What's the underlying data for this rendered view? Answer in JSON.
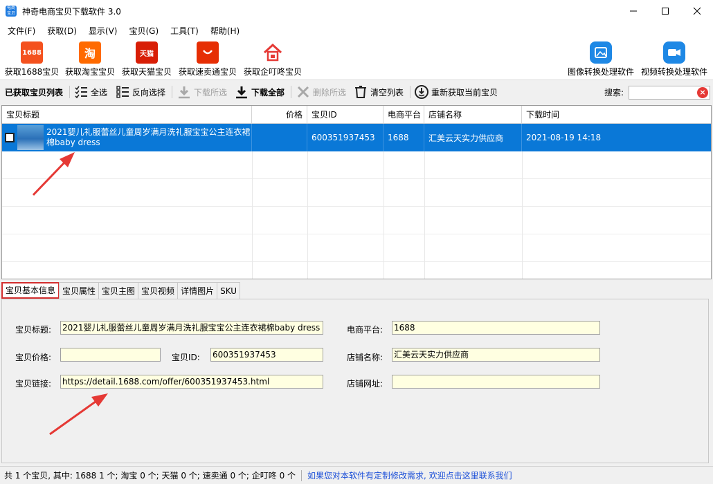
{
  "window": {
    "title": "神奇电商宝贝下载软件 3.0",
    "icon_text": "电商宝贝"
  },
  "menu": [
    "文件(F)",
    "获取(D)",
    "显示(V)",
    "宝贝(G)",
    "工具(T)",
    "帮助(H)"
  ],
  "big_toolbar": {
    "btn_1688": {
      "label": "获取1688宝贝",
      "icon_text": "1688",
      "color": "#f4511e"
    },
    "btn_taobao": {
      "label": "获取淘宝宝贝",
      "icon_text": "淘",
      "color": "#ff6a00"
    },
    "btn_tmall": {
      "label": "获取天猫宝贝",
      "icon_text": "天猫",
      "color": "#d81e06"
    },
    "btn_aliexpress": {
      "label": "获取速卖通宝贝",
      "color": "#e62e04"
    },
    "btn_qidd": {
      "label": "获取企叮咚宝贝",
      "color": "#e53935"
    },
    "btn_image": {
      "label": "图像转换处理软件",
      "color": "#1e88e5"
    },
    "btn_video": {
      "label": "视频转换处理软件",
      "color": "#1e88e5"
    }
  },
  "small_toolbar": {
    "list_label": "已获取宝贝列表",
    "select_all": "全选",
    "invert_select": "反向选择",
    "download_selected": "下载所选",
    "download_all": "下载全部",
    "delete_selected": "删除所选",
    "clear_list": "清空列表",
    "refetch": "重新获取当前宝贝",
    "search_label": "搜索:",
    "search_value": ""
  },
  "grid": {
    "columns": [
      "宝贝标题",
      "价格",
      "宝贝ID",
      "电商平台",
      "店铺名称",
      "下载时间"
    ],
    "rows": [
      {
        "title": "2021婴儿礼服蕾丝儿童周岁满月洗礼服宝宝公主连衣裙棉baby dress",
        "price": "",
        "id": "600351937453",
        "platform": "1688",
        "shop": "汇美云天实力供应商",
        "time": "2021-08-19 14:18"
      }
    ]
  },
  "tabs": [
    "宝贝基本信息",
    "宝贝属性",
    "宝贝主图",
    "宝贝视频",
    "详情图片",
    "SKU"
  ],
  "form": {
    "title_label": "宝贝标题:",
    "title_value": "2021婴儿礼服蕾丝儿童周岁满月洗礼服宝宝公主连衣裙棉baby dress",
    "price_label": "宝贝价格:",
    "price_value": "",
    "id_label": "宝贝ID:",
    "id_value": "600351937453",
    "link_label": "宝贝链接:",
    "link_value": "https://detail.1688.com/offer/600351937453.html",
    "platform_label": "电商平台:",
    "platform_value": "1688",
    "shop_label": "店铺名称:",
    "shop_value": "汇美云天实力供应商",
    "shopurl_label": "店铺网址:",
    "shopurl_value": ""
  },
  "status": {
    "summary": "共 1 个宝贝, 其中: 1688 1 个; 淘宝 0 个; 天猫 0 个; 速卖通 0 个; 企叮咚 0 个",
    "link": "如果您对本软件有定制修改需求, 欢迎点击这里联系我们"
  },
  "colors": {
    "selection": "#0a78d7",
    "annotation_arrow": "#e53935",
    "field_bg": "#ffffe1"
  }
}
